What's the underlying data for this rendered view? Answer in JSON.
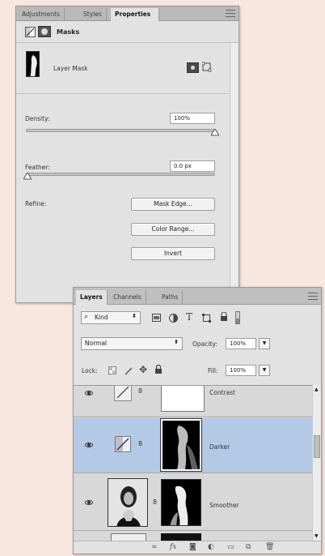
{
  "properties_panel": {
    "tabs": [
      "Adjustments",
      "Styles",
      "Properties"
    ],
    "active_tab": "Properties",
    "header_title": "Masks",
    "layer_mask_label": "Layer Mask",
    "density_label": "Density:",
    "density_value": "100%",
    "feather_label": "Feather:",
    "feather_value": "0.0 px",
    "refine_label": "Refine:",
    "mask_edge_button": "Mask Edge...",
    "color_range_button": "Color Range...",
    "invert_button": "Invert",
    "density_fraction": 1.0,
    "feather_fraction": 0.0
  },
  "layers_panel": {
    "tabs": [
      "Layers",
      "Channels",
      "Paths"
    ],
    "active_tab": "Layers",
    "kind_label": "Kind",
    "blend_mode": "Normal",
    "opacity_label": "Opacity:",
    "opacity_value": "100%",
    "lock_label": "Lock:",
    "fill_label": "Fill:",
    "fill_value": "100%",
    "layers": [
      {
        "name": "Contrast",
        "selected": false
      },
      {
        "name": "Darker",
        "selected": true
      },
      {
        "name": "Smoother",
        "selected": false
      }
    ],
    "filter_icons": [
      "image-filter-icon",
      "adjustment-filter-icon",
      "type-filter-icon",
      "shape-filter-icon",
      "smart-object-filter-icon"
    ],
    "footer_icons": [
      "link-layers-icon",
      "fx-icon",
      "add-mask-icon",
      "new-fill-adjustment-icon",
      "new-group-icon",
      "new-layer-icon",
      "trash-icon"
    ],
    "fx_text": "fx"
  },
  "colors": {
    "background": "#f7e7de",
    "panel": "#e2e2e2",
    "selected_row": "#b4c9e6"
  }
}
